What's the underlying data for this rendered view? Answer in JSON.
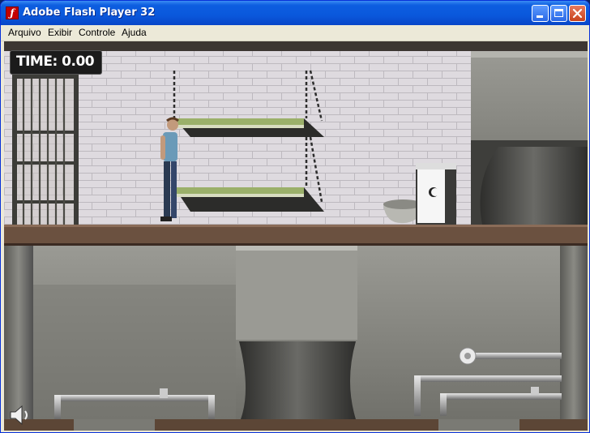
{
  "window": {
    "title": "Adobe Flash Player 32"
  },
  "menu": [
    {
      "label": "Arquivo"
    },
    {
      "label": "Exibir"
    },
    {
      "label": "Controle"
    },
    {
      "label": "Ajuda"
    }
  ],
  "game": {
    "timer": "TIME: 0.00"
  },
  "icons": {
    "app": "flash-icon",
    "sound": "speaker-icon",
    "minimize": "minimize-icon",
    "maximize": "maximize-icon",
    "close": "close-icon"
  },
  "colors": {
    "titlebar": "#0a58dc",
    "brick_wall": "#dcd8dc",
    "floor": "#6b5140",
    "concrete": "#8a8a84",
    "timer_bg": "#1b1b1b"
  }
}
